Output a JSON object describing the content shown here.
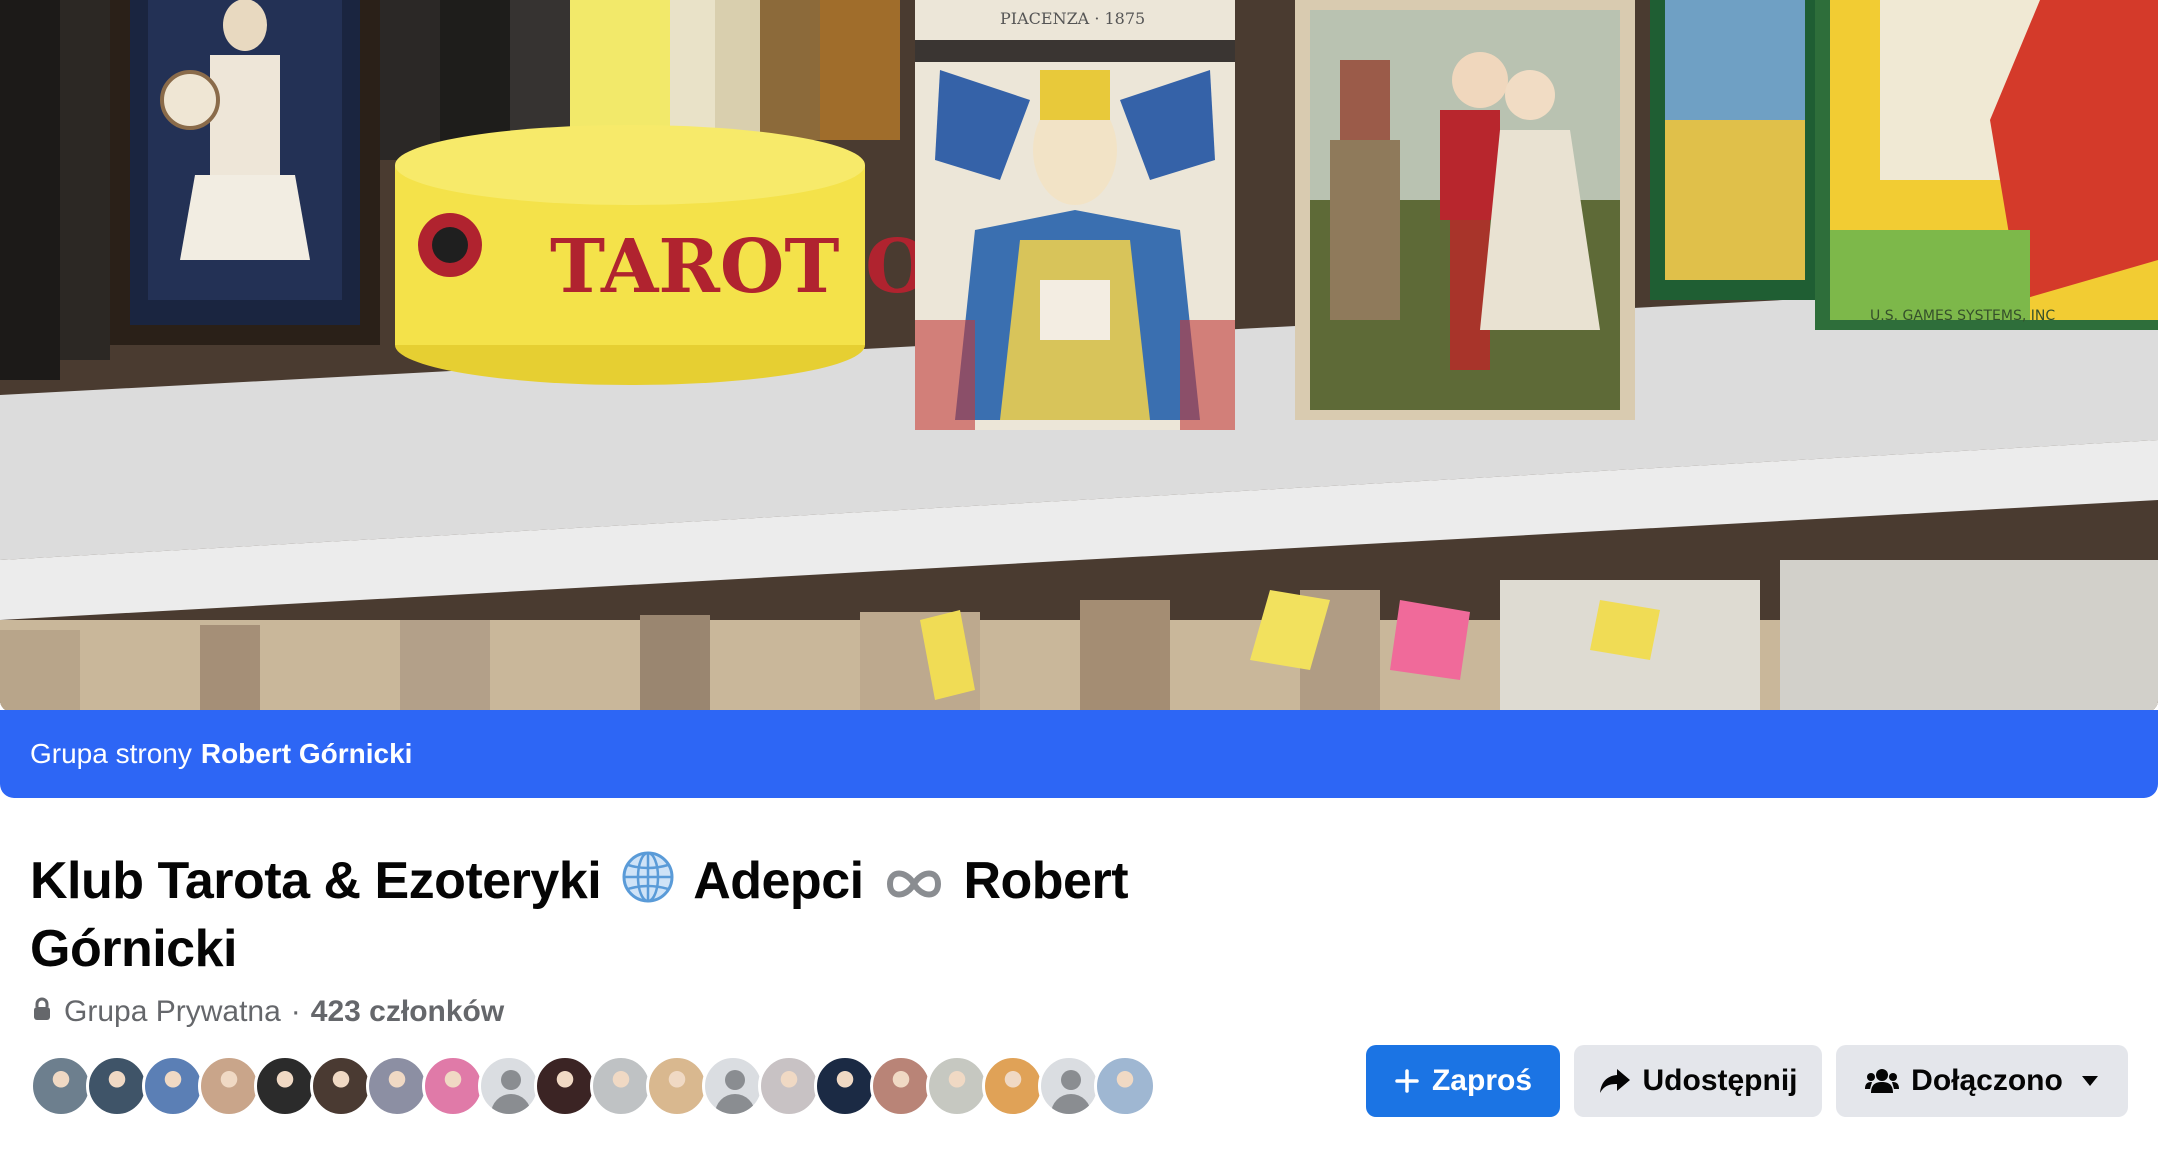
{
  "banner": {
    "prefix": "Grupa strony",
    "owner": "Robert Górnicki"
  },
  "cover": {
    "box_label": "TAROT ORIG",
    "card_caption": "PIACENZA · 1875",
    "deck_publisher": "U.S. GAMES SYSTEMS, INC"
  },
  "group": {
    "title_part1": "Klub Tarota & Ezoteryki",
    "title_part2": "Adepci",
    "title_part3": "Robert Górnicki",
    "title_emoji_1": "globe-icon",
    "title_emoji_2": "infinity-icon",
    "privacy": "Grupa Prywatna",
    "separator": "·",
    "members": "423 członków"
  },
  "member_avatars": [
    {
      "kind": "photo",
      "color": "#6d7f8e"
    },
    {
      "kind": "photo",
      "color": "#3f5468"
    },
    {
      "kind": "photo",
      "color": "#5b7fb5"
    },
    {
      "kind": "photo",
      "color": "#c9a58a"
    },
    {
      "kind": "photo",
      "color": "#2b2b2b"
    },
    {
      "kind": "photo",
      "color": "#4a3a32"
    },
    {
      "kind": "photo",
      "color": "#8c8fa3"
    },
    {
      "kind": "photo",
      "color": "#e07aa8"
    },
    {
      "kind": "blank",
      "color": "#dadde1"
    },
    {
      "kind": "photo",
      "color": "#3b2424"
    },
    {
      "kind": "photo",
      "color": "#bfc2c4"
    },
    {
      "kind": "photo",
      "color": "#d9b88f"
    },
    {
      "kind": "blank",
      "color": "#dadde1"
    },
    {
      "kind": "photo",
      "color": "#c8c2c4"
    },
    {
      "kind": "photo",
      "color": "#1b2a44"
    },
    {
      "kind": "photo",
      "color": "#b98477"
    },
    {
      "kind": "photo",
      "color": "#c6c8c1"
    },
    {
      "kind": "photo",
      "color": "#e0a257"
    },
    {
      "kind": "blank",
      "color": "#dadde1"
    },
    {
      "kind": "photo",
      "color": "#9fb7d2"
    }
  ],
  "actions": {
    "invite_label": "Zaproś",
    "share_label": "Udostępnij",
    "joined_label": "Dołączono"
  },
  "colors": {
    "banner_blue": "#2d66f5",
    "primary_button": "#1b74e4",
    "secondary_button": "#e4e6eb",
    "meta_gray": "#65676b"
  }
}
